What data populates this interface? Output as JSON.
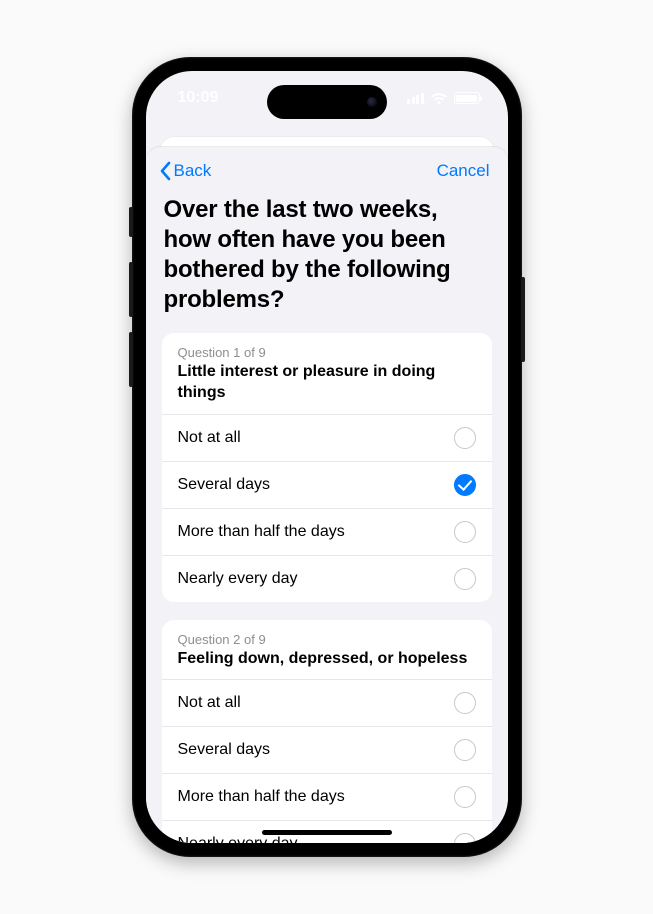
{
  "statusbar": {
    "time": "10:09"
  },
  "nav": {
    "back": "Back",
    "cancel": "Cancel"
  },
  "heading": "Over the last two weeks, how often have you been bothered by the following problems?",
  "questions": [
    {
      "counter": "Question 1 of 9",
      "title": "Little interest or pleasure in doing things",
      "options": [
        {
          "label": "Not at all",
          "selected": false
        },
        {
          "label": "Several days",
          "selected": true
        },
        {
          "label": "More than half the days",
          "selected": false
        },
        {
          "label": "Nearly every day",
          "selected": false
        }
      ]
    },
    {
      "counter": "Question 2 of 9",
      "title": "Feeling down, depressed, or hopeless",
      "options": [
        {
          "label": "Not at all",
          "selected": false
        },
        {
          "label": "Several days",
          "selected": false
        },
        {
          "label": "More than half the days",
          "selected": false
        },
        {
          "label": "Nearly every day",
          "selected": false
        }
      ]
    }
  ]
}
